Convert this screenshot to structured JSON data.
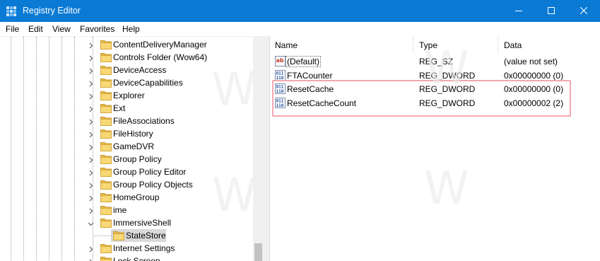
{
  "window": {
    "title": "Registry Editor",
    "accent_color": "#0a7ad4"
  },
  "menu": {
    "items": [
      "File",
      "Edit",
      "View",
      "Favorites",
      "Help"
    ]
  },
  "tree": {
    "items": [
      {
        "label": "ContentDeliveryManager",
        "expanded": false
      },
      {
        "label": "Controls Folder (Wow64)",
        "expanded": false
      },
      {
        "label": "DeviceAccess",
        "expanded": false
      },
      {
        "label": "DeviceCapabilities",
        "expanded": false
      },
      {
        "label": "Explorer",
        "expanded": false
      },
      {
        "label": "Ext",
        "expanded": false
      },
      {
        "label": "FileAssociations",
        "expanded": false
      },
      {
        "label": "FileHistory",
        "expanded": false
      },
      {
        "label": "GameDVR",
        "expanded": false
      },
      {
        "label": "Group Policy",
        "expanded": false
      },
      {
        "label": "Group Policy Editor",
        "expanded": false
      },
      {
        "label": "Group Policy Objects",
        "expanded": false
      },
      {
        "label": "HomeGroup",
        "expanded": false
      },
      {
        "label": "ime",
        "expanded": false
      },
      {
        "label": "ImmersiveShell",
        "expanded": true
      },
      {
        "label": "StateStore",
        "child": true,
        "selected": true
      },
      {
        "label": "Internet Settings",
        "expanded": false
      },
      {
        "label": "Lock Screen",
        "expanded": false
      }
    ]
  },
  "list": {
    "columns": [
      "Name",
      "Type",
      "Data"
    ],
    "rows": [
      {
        "name": "(Default)",
        "type": "REG_SZ",
        "data": "(value not set)",
        "icon": "string-value-icon"
      },
      {
        "name": "FTACounter",
        "type": "REG_DWORD",
        "data": "0x00000000 (0)",
        "icon": "dword-value-icon"
      },
      {
        "name": "ResetCache",
        "type": "REG_DWORD",
        "data": "0x00000000 (0)",
        "icon": "dword-value-icon"
      },
      {
        "name": "ResetCacheCount",
        "type": "REG_DWORD",
        "data": "0x00000002 (2)",
        "icon": "dword-value-icon"
      }
    ],
    "highlight_color": "#f0a8b0"
  },
  "watermark": {
    "text": "http://winaero.com"
  }
}
